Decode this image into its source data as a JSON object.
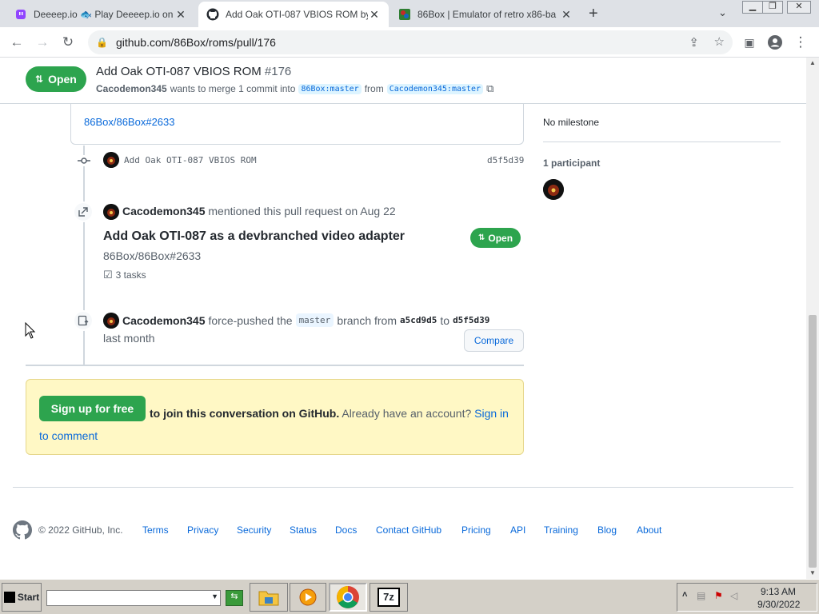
{
  "browser": {
    "tabs": [
      {
        "title": "Deeeep.io 🐟 Play Deeeep.io on C"
      },
      {
        "title": "Add Oak OTI-087 VBIOS ROM by"
      },
      {
        "title": "86Box | Emulator of retro x86-ba"
      }
    ],
    "url": "github.com/86Box/roms/pull/176"
  },
  "pr_header": {
    "state": "Open",
    "title": "Add Oak OTI-087 VBIOS ROM",
    "number": "#176",
    "author": "Cacodemon345",
    "merge_text": "wants to merge 1 commit into",
    "base_branch": "86Box:master",
    "from_text": "from",
    "head_branch": "Cacodemon345:master"
  },
  "timeline": {
    "ref_link": "86Box/86Box#2633",
    "commit": {
      "message": "Add Oak OTI-087 VBIOS ROM",
      "sha": "d5f5d39"
    },
    "mention": {
      "user": "Cacodemon345",
      "text": "mentioned this pull request on Aug 22",
      "issue_title": "Add Oak OTI-087 as a devbranched video adapter",
      "issue_state": "Open",
      "issue_ref": "86Box/86Box#2633",
      "tasks": "3 tasks"
    },
    "push": {
      "user": "Cacodemon345",
      "text1": "force-pushed the",
      "branch": "master",
      "text2": "branch from",
      "from_sha": "a5cd9d5",
      "to_text": "to",
      "to_sha": "d5f5d39",
      "time": "last month",
      "compare": "Compare"
    }
  },
  "signup": {
    "button": "Sign up for free",
    "text": "to join this conversation on GitHub.",
    "text2": "Already have an account?",
    "signin": "Sign in to comment"
  },
  "sidebar": {
    "milestone": "No milestone",
    "participants": "1 participant"
  },
  "footer": {
    "copyright": "© 2022 GitHub, Inc.",
    "links": [
      "Terms",
      "Privacy",
      "Security",
      "Status",
      "Docs",
      "Contact GitHub",
      "Pricing",
      "API",
      "Training",
      "Blog",
      "About"
    ]
  },
  "taskbar": {
    "start": "Start",
    "time": "9:13 AM",
    "date": "9/30/2022"
  },
  "colors": {
    "green": "#2da44e",
    "link": "#0969da",
    "signup_bg": "#fff8c5"
  }
}
